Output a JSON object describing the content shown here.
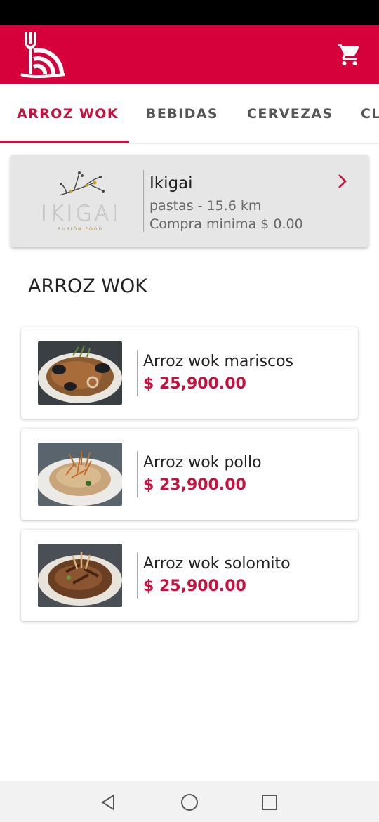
{
  "tabs": [
    {
      "label": "ARROZ WOK",
      "active": true
    },
    {
      "label": "BEBIDAS",
      "active": false
    },
    {
      "label": "CERVEZAS",
      "active": false
    },
    {
      "label": "CL",
      "active": false
    }
  ],
  "restaurant": {
    "name": "Ikigai",
    "info": "pastas - 15.6 km",
    "minimum": "Compra minima $ 0.00",
    "logo_text": "IKIGAI",
    "logo_subtext": "FUSIÓN FOOD"
  },
  "section_title": "ARROZ WOK",
  "dishes": [
    {
      "name": "Arroz wok mariscos",
      "price": "$ 25,900.00"
    },
    {
      "name": "Arroz wok pollo",
      "price": "$ 23,900.00"
    },
    {
      "name": "Arroz wok solomito",
      "price": "$ 25,900.00"
    }
  ],
  "icons": {
    "logo": "fork-wifi-logo-icon",
    "cart": "shopping-cart-icon",
    "chevron": "chevron-right-icon",
    "nav_back": "triangle-back-icon",
    "nav_home": "circle-home-icon",
    "nav_recents": "square-recents-icon"
  },
  "colors": {
    "brand": "#d6003a",
    "accent": "#c8103e",
    "card_bg": "#e6e6e6"
  }
}
